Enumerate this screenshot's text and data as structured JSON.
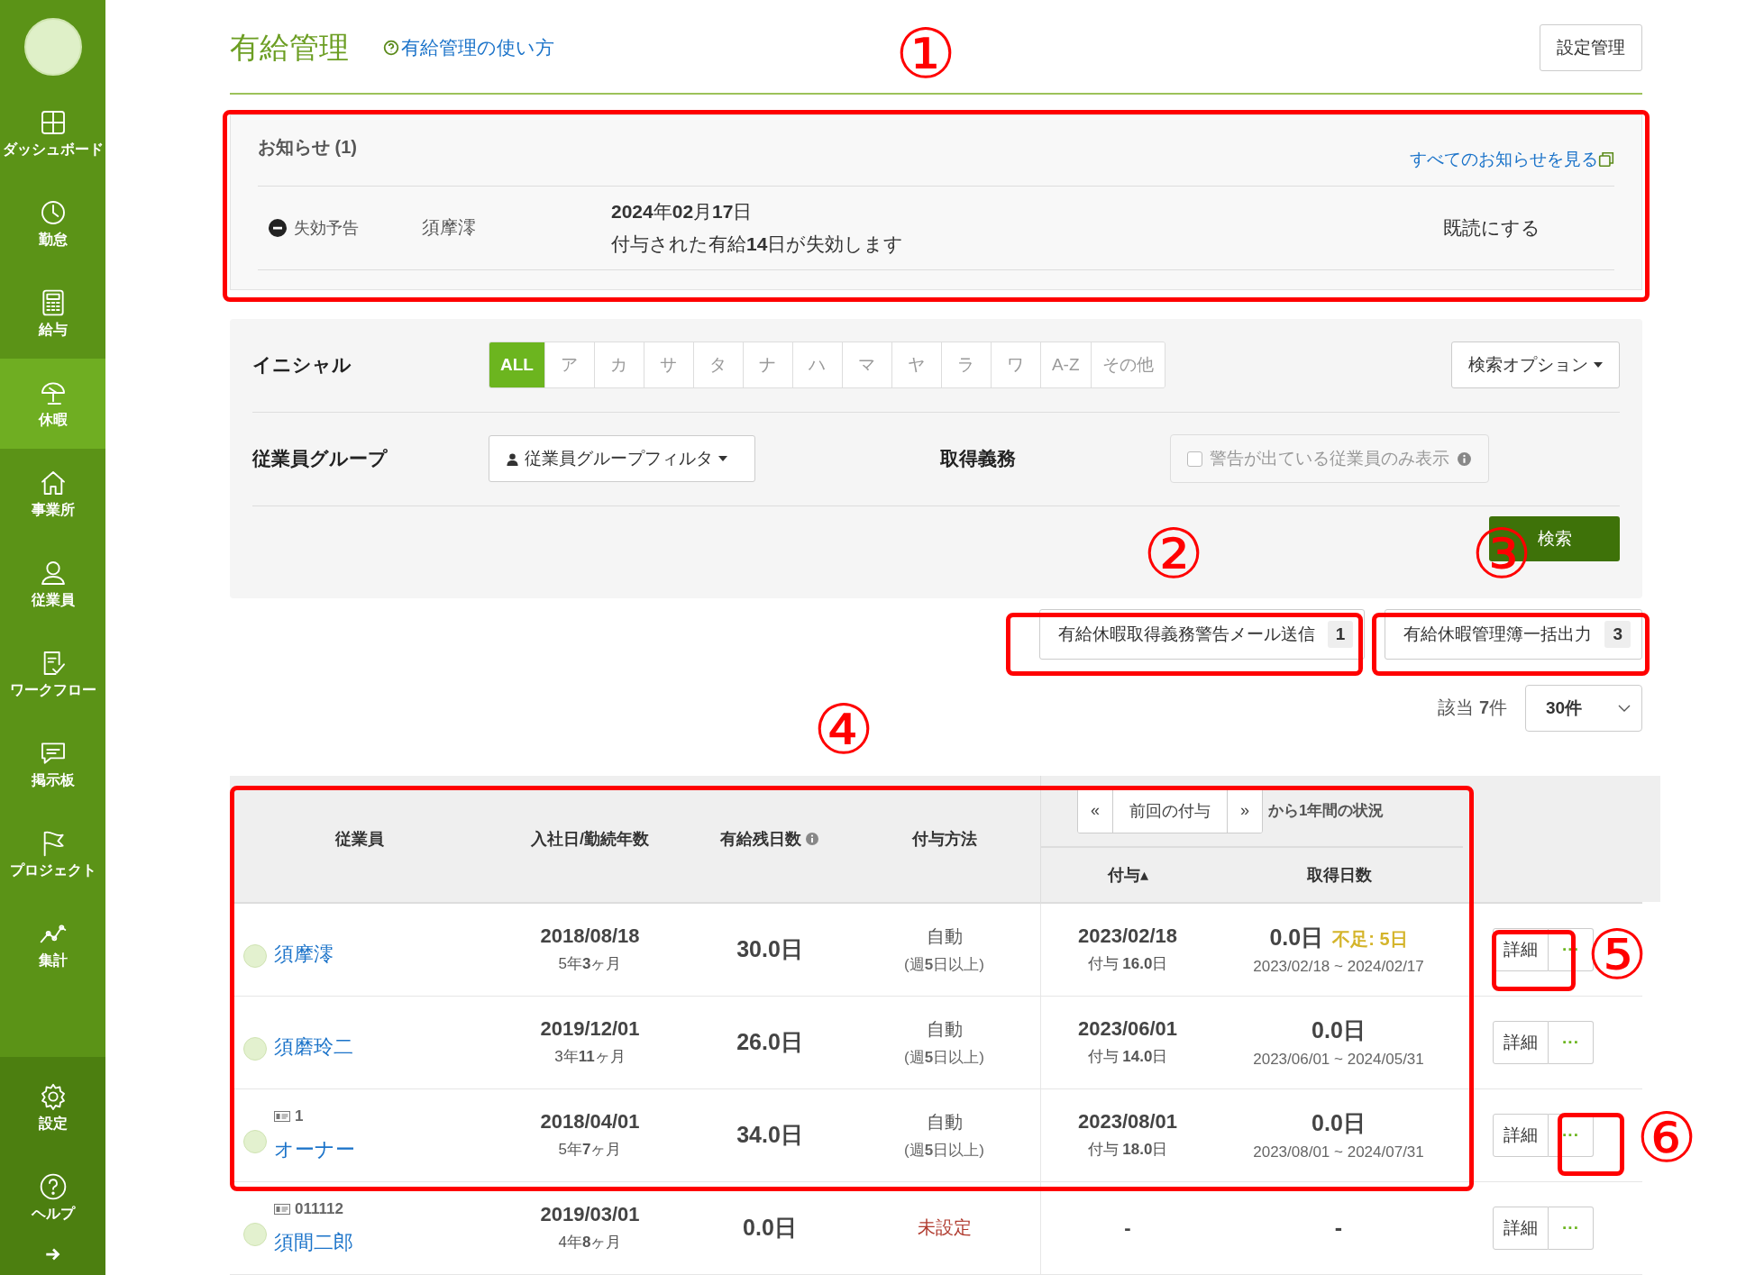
{
  "sidebar": {
    "items": [
      {
        "label": "ダッシュボード",
        "selected": false
      },
      {
        "label": "勤怠",
        "selected": false
      },
      {
        "label": "給与",
        "selected": false
      },
      {
        "label": "休暇",
        "selected": true
      },
      {
        "label": "事業所",
        "selected": false
      },
      {
        "label": "従業員",
        "selected": false
      },
      {
        "label": "ワークフロー",
        "selected": false
      },
      {
        "label": "掲示板",
        "selected": false
      },
      {
        "label": "プロジェクト",
        "selected": false
      },
      {
        "label": "集計",
        "selected": false
      }
    ],
    "bottom_items": [
      {
        "label": "設定"
      },
      {
        "label": "ヘルプ"
      }
    ]
  },
  "page": {
    "title": "有給管理",
    "help_link": "有給管理の使い方",
    "settings_button": "設定管理"
  },
  "notices": {
    "title": "お知らせ (1)",
    "all_link": "すべてのお知らせを見る",
    "items": [
      {
        "type": "失効予告",
        "employee": "須摩澪",
        "date": "**2024**年**02**月**17**日",
        "message": "付与された有給**14**日が失効します",
        "action": "既読にする"
      }
    ]
  },
  "filters": {
    "initial_label": "イニシャル",
    "initials": [
      {
        "label": "ALL",
        "selected": true
      },
      {
        "label": "ア",
        "selected": false
      },
      {
        "label": "カ",
        "selected": false
      },
      {
        "label": "サ",
        "selected": false
      },
      {
        "label": "タ",
        "selected": false
      },
      {
        "label": "ナ",
        "selected": false
      },
      {
        "label": "ハ",
        "selected": false
      },
      {
        "label": "マ",
        "selected": false
      },
      {
        "label": "ヤ",
        "selected": false
      },
      {
        "label": "ラ",
        "selected": false
      },
      {
        "label": "ワ",
        "selected": false
      },
      {
        "label": "A-Z",
        "selected": false
      },
      {
        "label": "その他",
        "selected": false
      }
    ],
    "search_options": "検索オプション",
    "group_label": "従業員グループ",
    "group_filter": "従業員グループフィルタ",
    "duty_label": "取得義務",
    "warning_only": {
      "label": "警告が出ている従業員のみ表示",
      "checked": false
    },
    "search_button": "検索"
  },
  "actions": [
    {
      "label": "有給休暇取得義務警告メール送信",
      "count": "1"
    },
    {
      "label": "有給休暇管理簿一括出力",
      "count": "3"
    }
  ],
  "result_count": "該当 **7**件",
  "per_page": "30件",
  "table": {
    "columns": [
      "従業員",
      "入社日/勤続年数",
      "有給残日数",
      "付与方法"
    ],
    "period_prev": "«",
    "period_label": "前回の付与",
    "period_next": "»",
    "period_suffix": "から1年間の状況",
    "sub_columns": [
      "付与▴",
      "取得日数"
    ],
    "rows": [
      {
        "code": "",
        "name": "須摩澪",
        "hire_date": "2018/08/18",
        "tenure": "5年**3**ヶ月",
        "balance": "30.0日",
        "method": "自動",
        "method_note": "(週**5**日以上)",
        "method_set": true,
        "grant_date": "2023/02/18",
        "grant_amount": "付与 **16.0**日",
        "taken": "0.0日",
        "shortage": "不足: 5日",
        "period": "2023/02/18 ~ 2024/02/17",
        "detail": "詳細",
        "more": "···"
      },
      {
        "code": "",
        "name": "須磨玲二",
        "hire_date": "2019/12/01",
        "tenure": "3年**11**ヶ月",
        "balance": "26.0日",
        "method": "自動",
        "method_note": "(週**5**日以上)",
        "method_set": true,
        "grant_date": "2023/06/01",
        "grant_amount": "付与 **14.0**日",
        "taken": "0.0日",
        "shortage": "",
        "period": "2023/06/01 ~ 2024/05/31",
        "detail": "詳細",
        "more": "···"
      },
      {
        "code": "1",
        "name": "オーナー",
        "hire_date": "2018/04/01",
        "tenure": "5年**7**ヶ月",
        "balance": "34.0日",
        "method": "自動",
        "method_note": "(週**5**日以上)",
        "method_set": true,
        "grant_date": "2023/08/01",
        "grant_amount": "付与 **18.0**日",
        "taken": "0.0日",
        "shortage": "",
        "period": "2023/08/01 ~ 2024/07/31",
        "detail": "詳細",
        "more": "···"
      },
      {
        "code": "011112",
        "name": "須間二郎",
        "hire_date": "2019/03/01",
        "tenure": "4年**8**ヶ月",
        "balance": "0.0日",
        "method": "未設定",
        "method_note": "",
        "method_set": false,
        "grant_date": "-",
        "grant_amount": "",
        "taken": "-",
        "shortage": "",
        "period": "",
        "detail": "詳細",
        "more": "···"
      }
    ]
  },
  "annotations": [
    {
      "label": "①"
    },
    {
      "label": "②"
    },
    {
      "label": "③"
    },
    {
      "label": "④"
    },
    {
      "label": "⑤"
    },
    {
      "label": "⑥"
    }
  ]
}
